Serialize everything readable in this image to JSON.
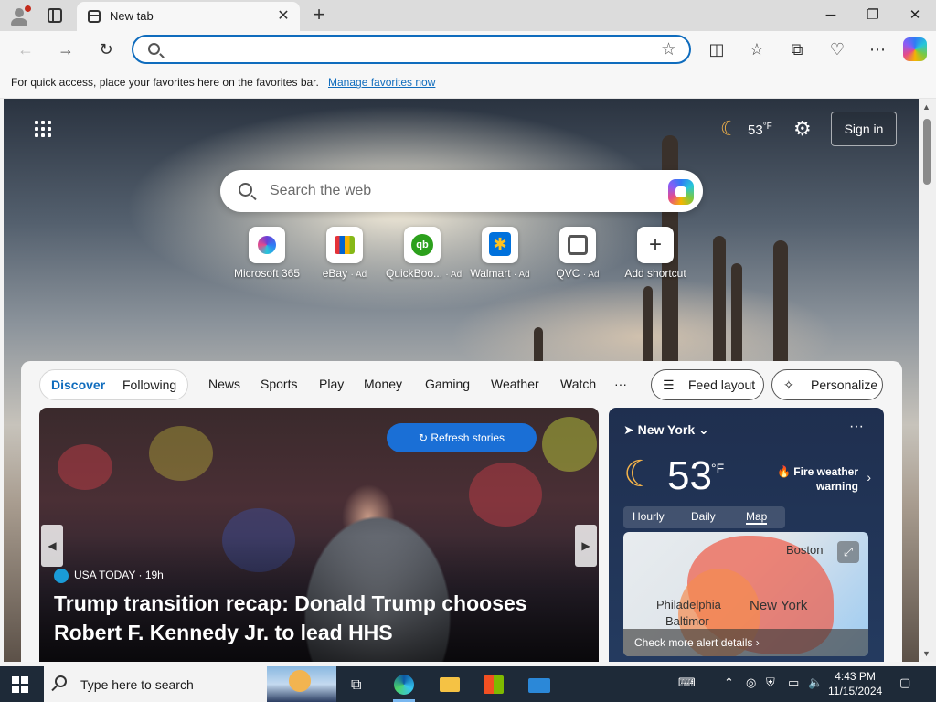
{
  "browser": {
    "tab_title": "New tab",
    "address_value": "",
    "fav_msg": "For quick access, place your favorites here on the favorites bar.",
    "fav_link": "Manage favorites now"
  },
  "ntp": {
    "weather_temp": "53",
    "weather_unit": "°F",
    "signin_label": "Sign in",
    "search_placeholder": "Search the web",
    "shortcuts": [
      {
        "name": "Microsoft 365",
        "ad": ""
      },
      {
        "name": "eBay",
        "ad": "· Ad"
      },
      {
        "name": "QuickBoo...",
        "ad": "· Ad"
      },
      {
        "name": "Walmart",
        "ad": "· Ad"
      },
      {
        "name": "QVC",
        "ad": "· Ad"
      },
      {
        "name": "Add shortcut",
        "ad": ""
      }
    ]
  },
  "feed": {
    "tabs": [
      "Discover",
      "Following"
    ],
    "nav": [
      "News",
      "Sports",
      "Play",
      "Money",
      "Gaming",
      "Weather",
      "Watch",
      "···"
    ],
    "feed_layout_label": "Feed layout",
    "personalize_label": "Personalize",
    "refresh_label": "Refresh stories",
    "story": {
      "source": "USA TODAY",
      "age": "· 19h",
      "headline": "Trump transition recap: Donald Trump chooses Robert F. Kennedy Jr. to lead HHS"
    },
    "weather_card": {
      "location": "New York",
      "temp": "53",
      "unit": "°F",
      "alert_line1": "Fire weather",
      "alert_line2": "warning",
      "tabs": [
        "Hourly",
        "Daily",
        "Map"
      ],
      "cities": [
        "Boston",
        "New York",
        "Philadelphia",
        "Baltimor"
      ],
      "alert_details": "Check more alert details"
    }
  },
  "taskbar": {
    "search_placeholder": "Type here to search",
    "time": "4:43 PM",
    "date": "11/15/2024"
  },
  "colors": {
    "accent": "#0f6cbd",
    "refresh_button": "#1a6fd6",
    "taskbar": "#1e2a38"
  }
}
